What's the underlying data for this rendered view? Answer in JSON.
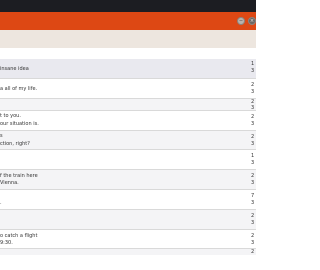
{
  "window": {
    "minimize_label": "−",
    "close_label": "×"
  },
  "rows": [
    {
      "lines": [
        "insane idea"
      ],
      "right": [
        "1",
        "3"
      ]
    },
    {
      "lines": [
        "",
        "a all of my life."
      ],
      "right": [
        "2",
        "3"
      ]
    },
    {
      "lines": [
        ""
      ],
      "right": [
        "2",
        "3"
      ]
    },
    {
      "lines": [
        "t to you.",
        "our situation is."
      ],
      "right": [
        "2",
        "3"
      ]
    },
    {
      "lines": [
        "s",
        "ction, right?"
      ],
      "right": [
        "2",
        "3"
      ]
    },
    {
      "lines": [
        ""
      ],
      "right": [
        "1",
        "3"
      ]
    },
    {
      "lines": [
        "f the train here",
        "Vienna."
      ],
      "right": [
        "2",
        "3"
      ]
    },
    {
      "lines": [
        "",
        "."
      ],
      "right": [
        "7",
        "3"
      ]
    },
    {
      "lines": [
        ""
      ],
      "right": [
        "2",
        "3"
      ]
    },
    {
      "lines": [
        "o catch a flight",
        "9:30."
      ],
      "right": [
        "2",
        "3"
      ]
    },
    {
      "lines": [
        ""
      ],
      "right": [
        "2"
      ]
    }
  ]
}
